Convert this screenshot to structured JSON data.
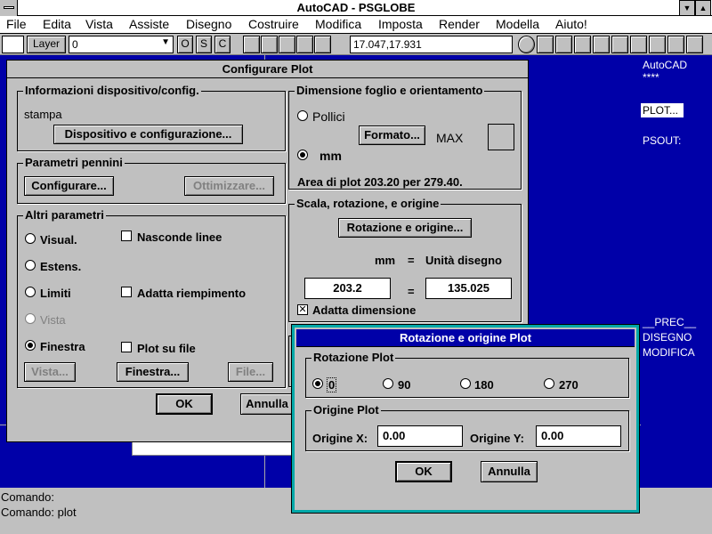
{
  "window": {
    "title": "AutoCAD - PSGLOBE"
  },
  "menu": [
    "File",
    "Edita",
    "Vista",
    "Assiste",
    "Disegno",
    "Costruire",
    "Modifica",
    "Imposta",
    "Render",
    "Modella",
    "Aiuto!"
  ],
  "toolbar": {
    "layer_label": "Layer",
    "layer_value": "0",
    "osc": [
      "O",
      "S",
      "C"
    ],
    "coords": "17.047,17.931"
  },
  "sidemenu": {
    "items": [
      "AutoCAD",
      "****",
      "PLOT...",
      "PSOUT:",
      "__PREC__",
      "DISEGNO",
      "MODIFICA"
    ]
  },
  "command": {
    "line1": "Comando:",
    "line2": "Comando: plot"
  },
  "plot_dialog": {
    "title": "Configurare Plot",
    "device_group": "Informazioni dispositivo/config.",
    "device_name": "stampa",
    "device_button": "Dispositivo e configurazione...",
    "pens_group": "Parametri pennini",
    "pens_configure": "Configurare...",
    "pens_optimize": "Ottimizzare...",
    "other_group": "Altri parametri",
    "radio_visual": "Visual.",
    "radio_estens": "Estens.",
    "radio_limiti": "Limiti",
    "radio_vista": "Vista",
    "radio_finestra": "Finestra",
    "check_hide": "Nasconde linee",
    "check_fill": "Adatta riempimento",
    "check_file": "Plot su file",
    "btn_vista": "Vista...",
    "btn_finestra": "Finestra...",
    "btn_file": "File...",
    "size_group": "Dimensione foglio e orientamento",
    "radio_pollici": "Pollici",
    "radio_mm": "mm",
    "btn_formato": "Formato...",
    "max_label": "MAX",
    "area_text": "Area di plot 203.20 per 279.40.",
    "scale_group": "Scala, rotazione, e origine",
    "btn_rotation": "Rotazione e origine...",
    "mm_label": "mm",
    "eq1": "=",
    "units_label": "Unità disegno",
    "mm_value": "203.2",
    "eq2": "=",
    "units_value": "135.025",
    "check_adapt": "Adatta dimensione",
    "ok": "OK",
    "cancel": "Annulla"
  },
  "rotation_dialog": {
    "title": "Rotazione e origine Plot",
    "rotation_group": "Rotazione Plot",
    "r0": "0",
    "r90": "90",
    "r180": "180",
    "r270": "270",
    "origin_group": "Origine Plot",
    "origin_x_label": "Origine X:",
    "origin_x_value": "0.00",
    "origin_y_label": "Origine Y:",
    "origin_y_value": "0.00",
    "ok": "OK",
    "cancel": "Annulla"
  },
  "colors": {
    "drawing_bg": "#0000a8",
    "dialog_bg": "#c0c0c0",
    "rotation_border": "#00a8a8",
    "rotation_title": "#0000a8"
  }
}
